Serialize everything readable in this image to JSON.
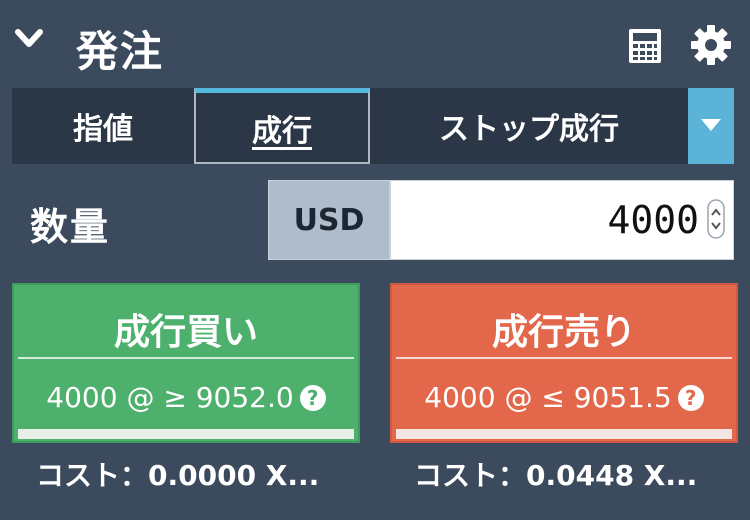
{
  "header": {
    "title": "発注",
    "collapse_icon": "chevron-down-icon",
    "calculator_icon": "calculator-icon",
    "settings_icon": "gear-icon"
  },
  "tabs": [
    {
      "label": "指値",
      "active": false
    },
    {
      "label": "成行",
      "active": true
    },
    {
      "label": "ストップ成行",
      "active": false
    }
  ],
  "quantity": {
    "label": "数量",
    "currency": "USD",
    "value": "4000"
  },
  "buy": {
    "label": "成行買い",
    "price_text": "4000 @ ≥ 9052.0",
    "help": "?",
    "cost": "コスト：0.0000 X..."
  },
  "sell": {
    "label": "成行売り",
    "price_text": "4000 @ ≤ 9051.5",
    "help": "?",
    "cost": "コスト：0.0448 X..."
  },
  "colors": {
    "background": "#3b4a5c",
    "buy": "#4db06c",
    "sell": "#e3674a",
    "accent": "#5bb4d8"
  }
}
